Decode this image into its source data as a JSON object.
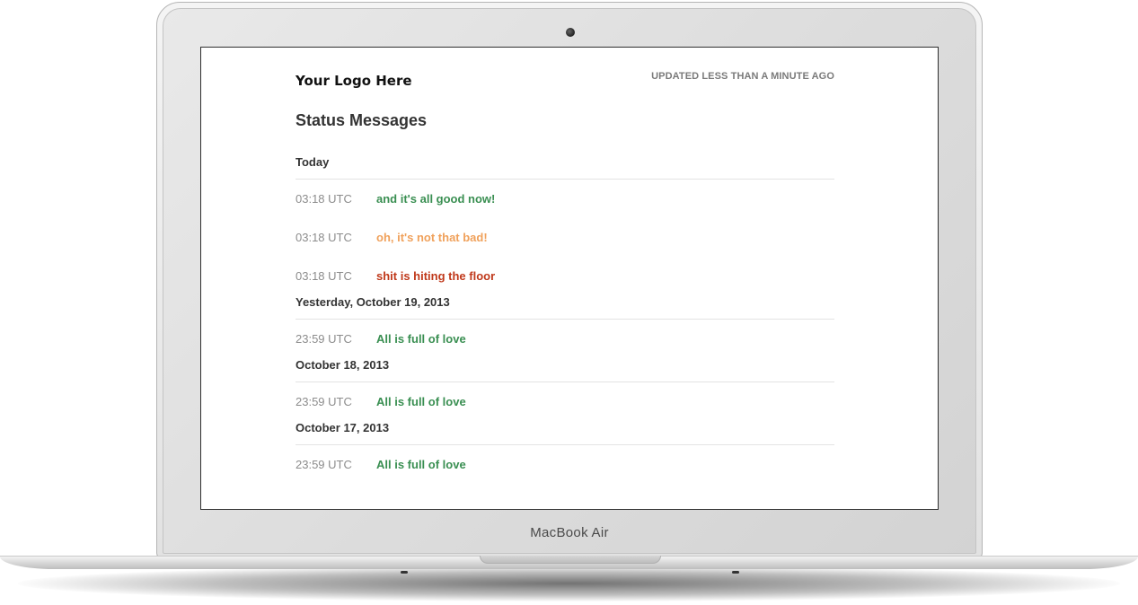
{
  "device": {
    "brand": "MacBook Air"
  },
  "header": {
    "logo": "Your Logo Here",
    "updated": "UPDATED LESS THAN A MINUTE AGO"
  },
  "page": {
    "title": "Status Messages"
  },
  "colors": {
    "good": "#3a8f52",
    "warning": "#f0a15b",
    "error": "#c0391b",
    "time": "#8c8c8c"
  },
  "days": [
    {
      "label": "Today",
      "messages": [
        {
          "time": "03:18 UTC",
          "text": "and it's all good now!",
          "status": "good"
        },
        {
          "time": "03:18 UTC",
          "text": "oh, it's not that bad!",
          "status": "warning"
        },
        {
          "time": "03:18 UTC",
          "text": "shit is hiting the floor",
          "status": "error"
        }
      ]
    },
    {
      "label": "Yesterday, October 19, 2013",
      "messages": [
        {
          "time": "23:59 UTC",
          "text": "All is full of love",
          "status": "good"
        }
      ]
    },
    {
      "label": "October 18, 2013",
      "messages": [
        {
          "time": "23:59 UTC",
          "text": "All is full of love",
          "status": "good"
        }
      ]
    },
    {
      "label": "October 17, 2013",
      "messages": [
        {
          "time": "23:59 UTC",
          "text": "All is full of love",
          "status": "good"
        }
      ]
    }
  ]
}
